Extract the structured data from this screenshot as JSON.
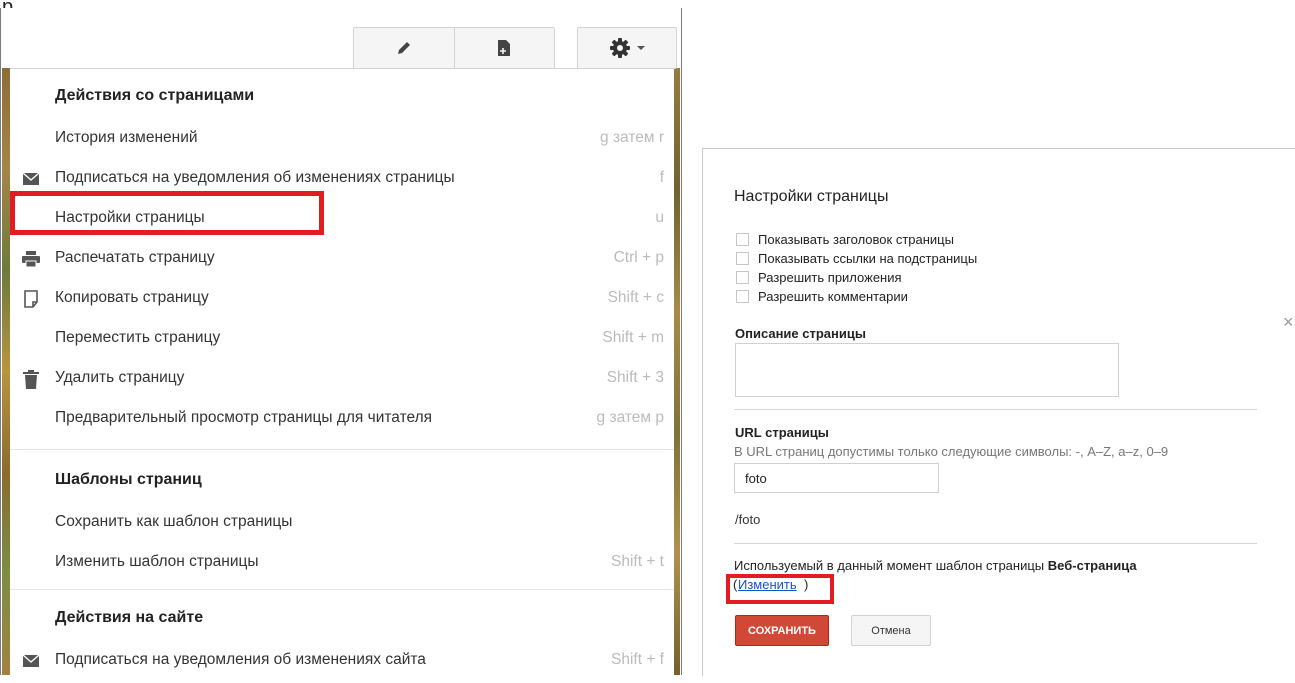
{
  "top_fragment": "р",
  "toolbar": {
    "edit_icon": "pencil-icon",
    "new_page_icon": "new-page-icon",
    "more_icon": "gear-icon",
    "dropdown_icon": "caret-down-icon"
  },
  "menu": {
    "sections": [
      {
        "title": "Действия со страницами"
      },
      {
        "title": "Шаблоны страниц"
      },
      {
        "title": "Действия на сайте"
      }
    ],
    "items": [
      {
        "label": "История изменений",
        "shortcut": "g затем r",
        "icon": ""
      },
      {
        "label": "Подписаться на уведомления об изменениях страницы",
        "shortcut": "f",
        "icon": "envelope-icon"
      },
      {
        "label": "Настройки страницы",
        "shortcut": "u",
        "icon": ""
      },
      {
        "label": "Распечатать страницу",
        "shortcut": "Ctrl + p",
        "icon": "printer-icon"
      },
      {
        "label": "Копировать страницу",
        "shortcut": "Shift + c",
        "icon": "copy-icon"
      },
      {
        "label": "Переместить страницу",
        "shortcut": "Shift + m",
        "icon": ""
      },
      {
        "label": "Удалить страницу",
        "shortcut": "Shift + 3",
        "icon": "trash-icon"
      },
      {
        "label": "Предварительный просмотр страницы для читателя",
        "shortcut": "g затем p",
        "icon": ""
      },
      {
        "label": "Сохранить как шаблон страницы",
        "shortcut": "",
        "icon": ""
      },
      {
        "label": "Изменить шаблон страницы",
        "shortcut": "Shift + t",
        "icon": ""
      },
      {
        "label": "Подписаться на уведомления об изменениях сайта",
        "shortcut": "Shift + f",
        "icon": "envelope-icon"
      }
    ]
  },
  "dialog": {
    "title": "Настройки страницы",
    "close": "×",
    "checkboxes": [
      {
        "label": "Показывать заголовок страницы",
        "checked": false
      },
      {
        "label": "Показывать ссылки на подстраницы",
        "checked": false
      },
      {
        "label": "Разрешить приложения",
        "checked": false
      },
      {
        "label": "Разрешить комментарии",
        "checked": false
      }
    ],
    "description_title": "Описание страницы",
    "description_value": "",
    "url_title": "URL страницы",
    "url_hint": "В URL страниц допустимы только следующие символы: -, A–Z, a–z, 0–9",
    "url_value": "foto",
    "url_path": "/foto",
    "template_prefix": "Используемый в данный момент шаблон страницы",
    "template_name": "Веб-страница",
    "change_open": "(",
    "change_link": "Изменить",
    "change_close": ")",
    "save_label": "СОХРАНИТЬ",
    "cancel_label": "Отмена"
  },
  "colors": {
    "highlight": "#e31b23",
    "save_button": "#d14836",
    "link": "#1155cc"
  }
}
